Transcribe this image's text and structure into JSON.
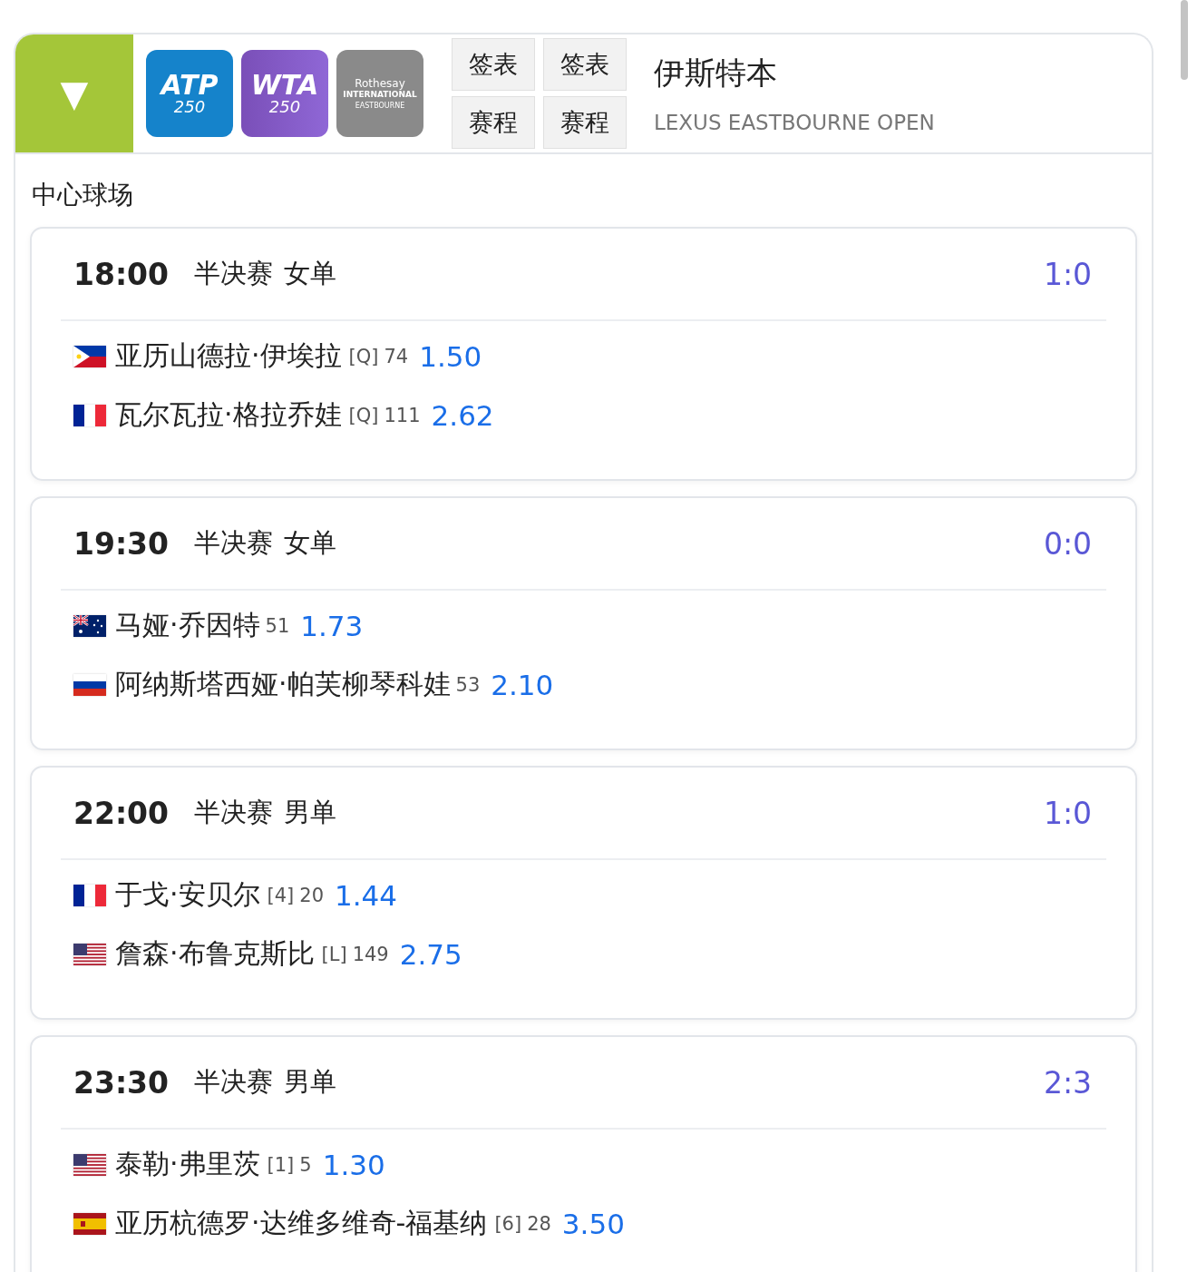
{
  "header": {
    "collapse_icon": "▼",
    "logos": [
      {
        "kind": "atp",
        "text": "ATP",
        "tier": "250"
      },
      {
        "kind": "wta",
        "text": "WTA",
        "tier": "250"
      },
      {
        "kind": "rothesay",
        "text": "Rothesay",
        "subtitle": "INTERNATIONAL",
        "tier": "EASTBOURNE"
      }
    ],
    "buttons": [
      "签表",
      "签表",
      "赛程",
      "赛程"
    ],
    "title": "伊斯特本",
    "subtitle": "LEXUS EASTBOURNE OPEN"
  },
  "court": "中心球场",
  "matches": [
    {
      "time": "18:00",
      "round": "半决赛",
      "event": "女单",
      "score": "1:0",
      "players": [
        {
          "flag": {
            "kind": "ph"
          },
          "name": "亚历山德拉·伊埃拉",
          "seed": "[Q]",
          "rank": "74",
          "odds": "1.50"
        },
        {
          "flag": {
            "kind": "fr"
          },
          "name": "瓦尔瓦拉·格拉乔娃",
          "seed": "[Q]",
          "rank": "111",
          "odds": "2.62"
        }
      ]
    },
    {
      "time": "19:30",
      "round": "半决赛",
      "event": "女单",
      "score": "0:0",
      "players": [
        {
          "flag": {
            "kind": "au"
          },
          "name": "马娅·乔因特",
          "rank": "51",
          "odds": "1.73"
        },
        {
          "flag": {
            "kind": "ru"
          },
          "name": "阿纳斯塔西娅·帕芙柳琴科娃",
          "rank": "53",
          "odds": "2.10"
        }
      ]
    },
    {
      "time": "22:00",
      "round": "半决赛",
      "event": "男单",
      "score": "1:0",
      "players": [
        {
          "flag": {
            "kind": "fr"
          },
          "name": "于戈·安贝尔",
          "seed": "[4]",
          "rank": "20",
          "odds": "1.44"
        },
        {
          "flag": {
            "kind": "us"
          },
          "name": "詹森·布鲁克斯比",
          "seed": "[L]",
          "rank": "149",
          "odds": "2.75"
        }
      ]
    },
    {
      "time": "23:30",
      "round": "半决赛",
      "event": "男单",
      "score": "2:3",
      "players": [
        {
          "flag": {
            "kind": "us"
          },
          "name": "泰勒·弗里茨",
          "seed": "[1]",
          "rank": "5",
          "odds": "1.30"
        },
        {
          "flag": {
            "kind": "es"
          },
          "name": "亚历杭德罗·达维多维奇-福基纳",
          "seed": "[6]",
          "rank": "28",
          "odds": "3.50"
        }
      ]
    }
  ]
}
